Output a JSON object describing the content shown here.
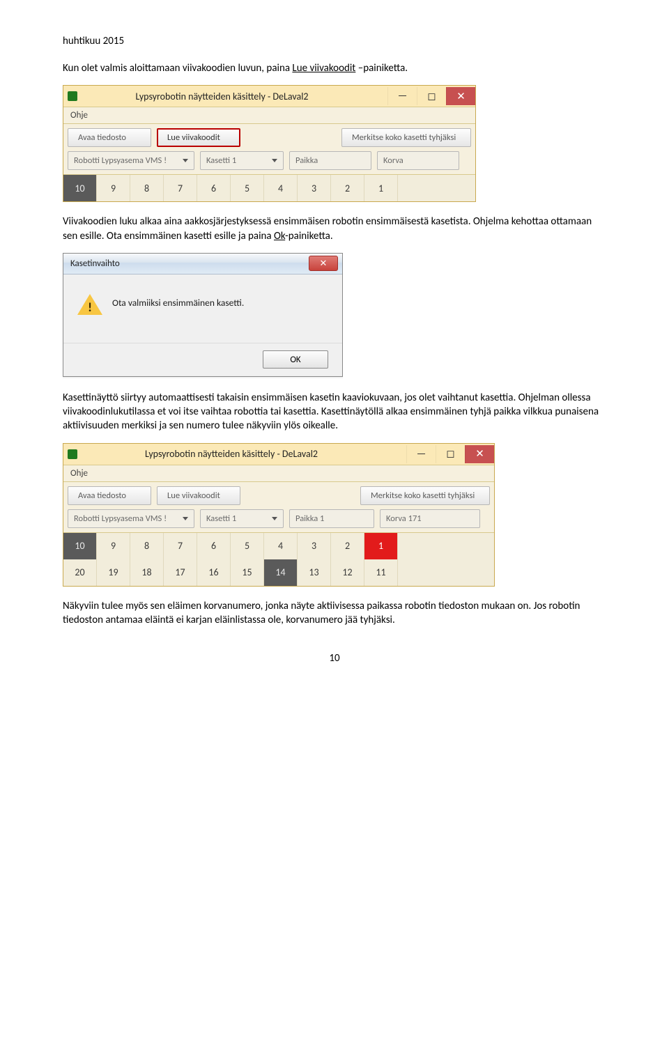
{
  "header_date": "huhtikuu 2015",
  "para1_a": "Kun olet valmis aloittamaan viivakoodien luvun, paina ",
  "para1_u": "Lue viivakoodit",
  "para1_b": " –painiketta.",
  "win": {
    "title": "Lypsyrobotin näytteiden käsittely - DeLaval2",
    "menu_ohje": "Ohje",
    "btn_avaa": "Avaa tiedosto",
    "btn_lue": "Lue viivakoodit",
    "btn_merkitse": "Merkitse koko kasetti tyhjäksi",
    "field_robotti": "Robotti Lypsyasema VMS !",
    "field_kasetti": "Kasetti 1",
    "field_paikka": "Paikka",
    "field_paikka2": "Paikka 1",
    "field_korva": "Korva",
    "field_korva2": "Korva 171",
    "nums1": [
      "10",
      "9",
      "8",
      "7",
      "6",
      "5",
      "4",
      "3",
      "2",
      "1"
    ],
    "nums2_top": [
      "10",
      "9",
      "8",
      "7",
      "6",
      "5",
      "4",
      "3",
      "2",
      "1"
    ],
    "nums2_bot": [
      "20",
      "19",
      "18",
      "17",
      "16",
      "15",
      "14",
      "13",
      "12",
      "11"
    ]
  },
  "para2_a": "Viivakoodien luku alkaa aina aakkosjärjestyksessä ensimmäisen robotin ensimmäisestä kasetista. Ohjelma kehottaa ottamaan sen esille. Ota ensimmäinen kasetti esille ja paina ",
  "para2_u": "Ok",
  "para2_b": "-painiketta.",
  "dialog": {
    "title": "Kasetinvaihto",
    "msg": "Ota valmiiksi ensimmäinen kasetti.",
    "ok": "OK"
  },
  "para3": "Kasettinäyttö siirtyy automaattisesti takaisin ensimmäisen kasetin kaaviokuvaan, jos olet vaihtanut kasettia. Ohjelman ollessa viivakoodinlukutilassa et voi itse vaihtaa robottia tai kasettia. Kasettinäytöllä alkaa ensimmäinen tyhjä paikka vilkkua punaisena aktiivisuuden merkiksi ja sen numero tulee näkyviin ylös oikealle.",
  "para4": "Näkyviin tulee myös sen eläimen korvanumero, jonka näyte aktiivisessa paikassa robotin tiedoston mukaan on. Jos robotin tiedoston antamaa eläintä ei karjan eläinlistassa ole, korvanumero jää tyhjäksi.",
  "page_number": "10"
}
